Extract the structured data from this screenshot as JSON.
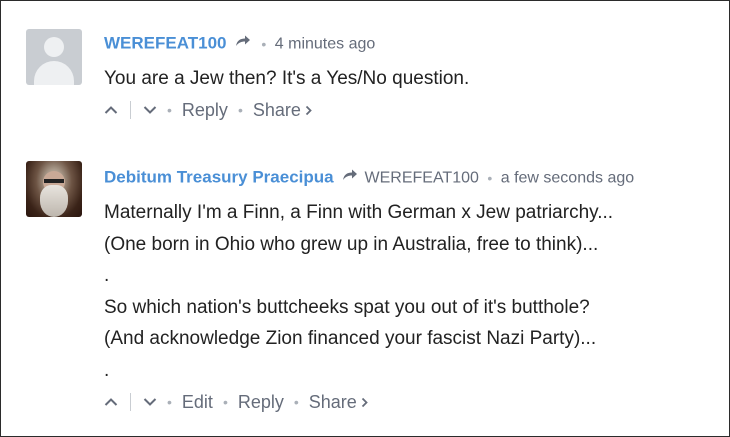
{
  "comments": [
    {
      "author": "WEREFEAT100",
      "reply_to": "",
      "time": "4 minutes ago",
      "lines": [
        "You are a Jew then? It's a Yes/No question."
      ],
      "actions": {
        "reply": "Reply",
        "share": "Share"
      }
    },
    {
      "author": "Debitum Treasury Praecipua",
      "reply_to": "WEREFEAT100",
      "time": "a few seconds ago",
      "lines": [
        "Maternally I'm a Finn, a Finn with German x Jew patriarchy...",
        "(One born in Ohio who grew up in Australia, free to think)...",
        ".",
        "So which nation's buttcheeks spat you out of it's butthole?",
        "(And acknowledge Zion financed your fascist Nazi Party)...",
        "."
      ],
      "actions": {
        "edit": "Edit",
        "reply": "Reply",
        "share": "Share"
      }
    }
  ],
  "colors": {
    "author": "#4a8fd6",
    "meta": "#656c7a",
    "text": "#222222",
    "border": "#2b2b2b"
  }
}
